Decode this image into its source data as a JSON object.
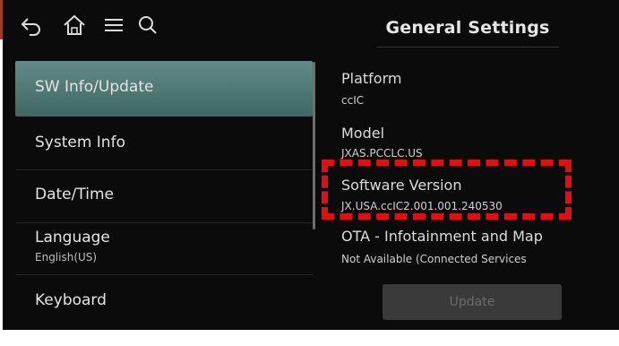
{
  "header": {
    "title": "General Settings"
  },
  "icons": {
    "back": "back-arrow-icon",
    "home": "home-icon",
    "menu": "menu-icon",
    "search": "search-icon"
  },
  "sidebar": {
    "items": [
      {
        "label": "SW Info/Update",
        "active": true
      },
      {
        "label": "System Info"
      },
      {
        "label": "Date/Time"
      },
      {
        "label": "Language",
        "sub": "English(US)"
      },
      {
        "label": "Keyboard"
      }
    ]
  },
  "content": {
    "platform": {
      "title": "Platform",
      "value": "ccIC"
    },
    "model": {
      "title": "Model",
      "value": "JXAS.PCCLC.US"
    },
    "software": {
      "title": "Software Version",
      "value": "JX.USA.ccIC2.001.001.240530"
    },
    "ota": {
      "title": "OTA - Infotainment and Map",
      "value": "Not Available (Connected Services"
    },
    "update_button": "Update"
  },
  "colors": {
    "accent": "#a23a2a",
    "active_item": "#5a8580",
    "highlight": "#e01010",
    "background": "#0b0b0b"
  }
}
